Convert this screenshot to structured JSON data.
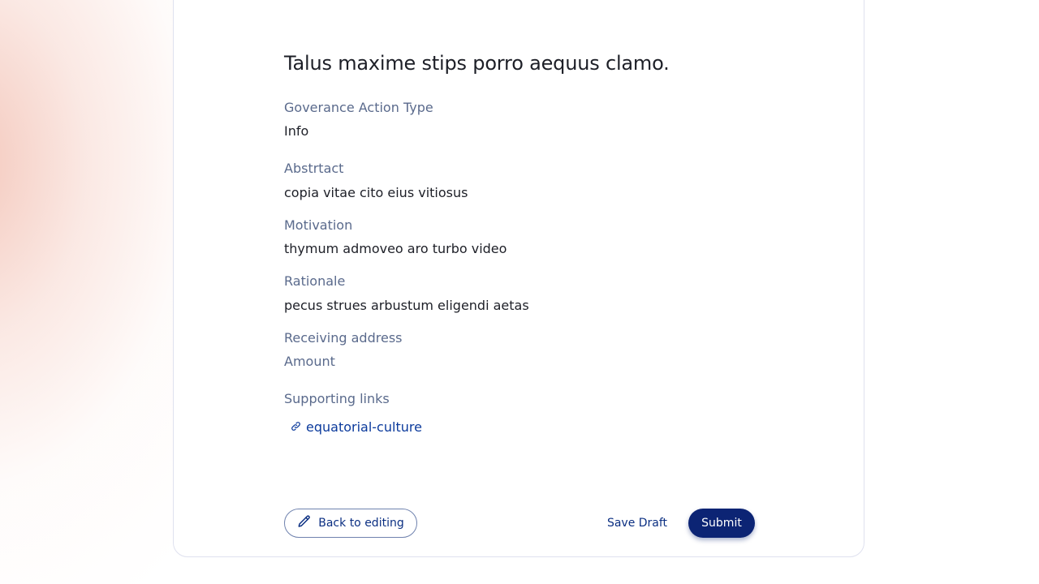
{
  "review": {
    "title": "Talus maxime stips porro aequus clamo.",
    "fields": [
      {
        "label": "Goverance Action Type",
        "value": "Info"
      },
      {
        "label": "Abstrtact",
        "value": "copia vitae cito eius vitiosus"
      },
      {
        "label": "Motivation",
        "value": "thymum admoveo aro turbo video"
      },
      {
        "label": "Rationale",
        "value": "pecus strues arbustum eligendi aetas"
      },
      {
        "label": "Receiving address",
        "value": ""
      },
      {
        "label": "Amount",
        "value": ""
      }
    ],
    "supporting_links_label": "Supporting links",
    "links": [
      {
        "text": "equatorial-culture",
        "icon": "link-icon"
      }
    ]
  },
  "actions": {
    "back_label": "Back to editing",
    "back_icon": "pencil-icon",
    "save_draft_label": "Save Draft",
    "submit_label": "Submit"
  },
  "colors": {
    "accent": "#0c2474",
    "link": "#0b3a9c",
    "label": "#5a6a8c",
    "text": "#1d1f27"
  }
}
